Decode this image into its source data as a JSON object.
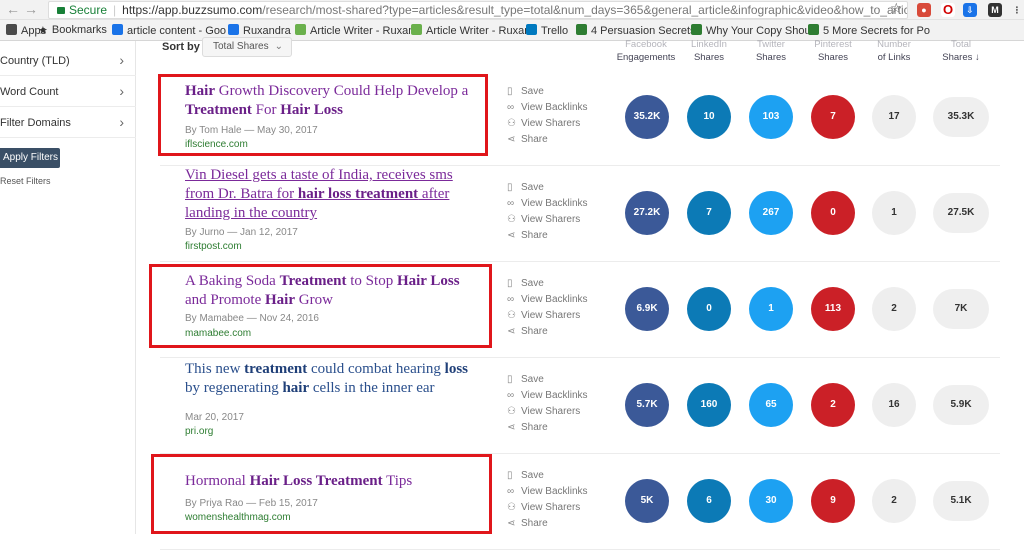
{
  "browser": {
    "secure_label": "Secure",
    "url_host": "https://app.buzzsumo.com",
    "url_path": "/research/most-shared?type=articles&result_type=total&num_days=365&general_article&infographic&video&how_to_article&list&..."
  },
  "bookmarks": [
    {
      "label": "Apps",
      "color": "#4a4a4a"
    },
    {
      "label": "Bookmarks",
      "color": "#333333"
    },
    {
      "label": "article content - Goo",
      "color": "#1a73e8"
    },
    {
      "label": "Ruxandra",
      "color": "#1a73e8"
    },
    {
      "label": "Article Writer - Ruxan",
      "color": "#6ab04c"
    },
    {
      "label": "Article Writer - Ruxan",
      "color": "#6ab04c"
    },
    {
      "label": "Trello",
      "color": "#0079bf"
    },
    {
      "label": "4 Persuasion Secrets",
      "color": "#2e7d32"
    },
    {
      "label": "Why Your Copy Shou",
      "color": "#2e7d32"
    },
    {
      "label": "5 More Secrets for Po",
      "color": "#2e7d32"
    }
  ],
  "sidebar": {
    "filters": [
      "Country (TLD)",
      "Word Count",
      "Filter Domains"
    ],
    "apply_label": "Apply Filters",
    "reset_label": "Reset Filters"
  },
  "sort": {
    "label": "Sort by",
    "value": "Total Shares"
  },
  "columns": [
    {
      "l1": "Facebook",
      "l2": "Engagements"
    },
    {
      "l1": "LinkedIn",
      "l2": "Shares"
    },
    {
      "l1": "Twitter",
      "l2": "Shares"
    },
    {
      "l1": "Pinterest",
      "l2": "Shares"
    },
    {
      "l1": "Number",
      "l2": "of Links"
    },
    {
      "l1": "Total",
      "l2": "Shares ↓"
    }
  ],
  "actions": [
    "Save",
    "View Backlinks",
    "View Sharers",
    "Share"
  ],
  "articles": [
    {
      "title_parts": [
        [
          "Hair",
          true
        ],
        [
          " Growth Discovery Could Help Develop a ",
          false
        ],
        [
          "Treatment",
          true
        ],
        [
          " For ",
          false
        ],
        [
          "Hair Loss",
          true
        ]
      ],
      "meta": "By Tom Hale — May 30, 2017",
      "domain": "iflscience.com",
      "fb": "35.2K",
      "li": "10",
      "tw": "103",
      "pin": "7",
      "links": "17",
      "total": "35.3K"
    },
    {
      "title_parts": [
        [
          "Vin Diesel gets a taste of India, receives sms from Dr. Batra for ",
          false
        ],
        [
          "hair loss treatment",
          true
        ],
        [
          " after landing in the country",
          false
        ]
      ],
      "meta": "By Jurno — Jan 12, 2017",
      "domain": "firstpost.com",
      "fb": "27.2K",
      "li": "7",
      "tw": "267",
      "pin": "0",
      "links": "1",
      "total": "27.5K"
    },
    {
      "title_parts": [
        [
          "A Baking Soda ",
          false
        ],
        [
          "Treatment",
          true
        ],
        [
          " to Stop ",
          false
        ],
        [
          "Hair Loss",
          true
        ],
        [
          " and Promote ",
          false
        ],
        [
          "Hair",
          true
        ],
        [
          " Grow",
          false
        ]
      ],
      "meta": "By Mamabee — Nov 24, 2016",
      "domain": "mamabee.com",
      "fb": "6.9K",
      "li": "0",
      "tw": "1",
      "pin": "113",
      "links": "2",
      "total": "7K"
    },
    {
      "title_parts": [
        [
          "This new ",
          false
        ],
        [
          "treatment",
          true
        ],
        [
          " could combat hearing ",
          false
        ],
        [
          "loss",
          true
        ],
        [
          " by regenerating ",
          false
        ],
        [
          "hair",
          true
        ],
        [
          " cells in the inner ear",
          false
        ]
      ],
      "meta": "Mar 20, 2017",
      "domain": "pri.org",
      "fb": "5.7K",
      "li": "160",
      "tw": "65",
      "pin": "2",
      "links": "16",
      "total": "5.9K"
    },
    {
      "title_parts": [
        [
          "Hormonal ",
          false
        ],
        [
          "Hair Loss Treatment",
          true
        ],
        [
          " Tips",
          false
        ]
      ],
      "meta": "By Priya Rao — Feb 15, 2017",
      "domain": "womenshealthmag.com",
      "fb": "5K",
      "li": "6",
      "tw": "30",
      "pin": "9",
      "links": "2",
      "total": "5.1K"
    }
  ],
  "colors": {
    "facebook": "#3b5998",
    "linkedin": "#0c7ab6",
    "twitter": "#1da1f2",
    "pinterest": "#cb2027",
    "highlight": "#e0161b"
  }
}
